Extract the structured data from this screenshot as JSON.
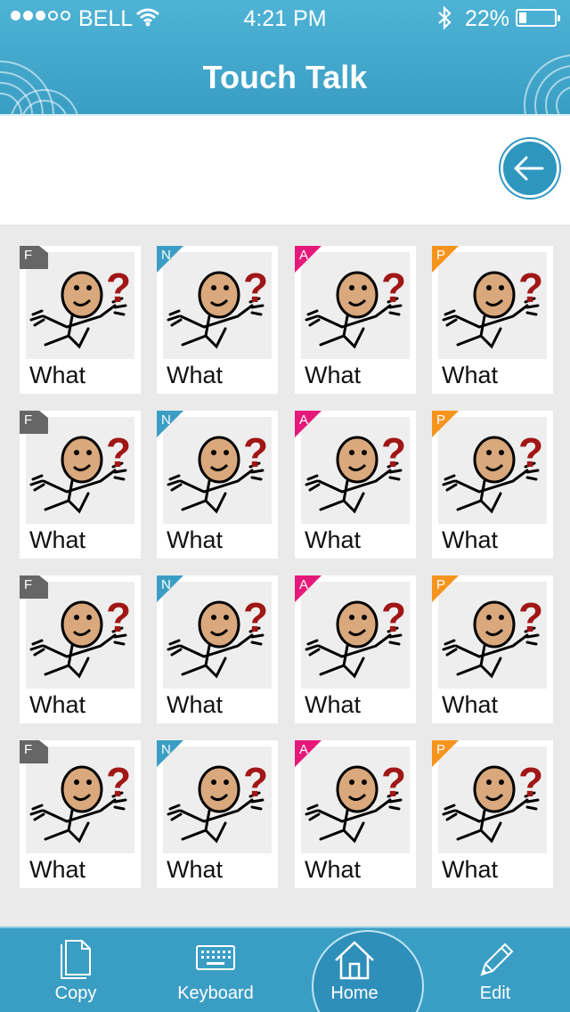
{
  "status_bar": {
    "carrier": "BELL",
    "time": "4:21 PM",
    "battery_percent": "22%",
    "battery_level": 0.22,
    "signal_bars_filled": 3,
    "signal_bars_total": 5
  },
  "header": {
    "title": "Touch Talk"
  },
  "message_bar": {
    "text": ""
  },
  "colors": {
    "header": "#3a9ec4",
    "F": "#666666",
    "N": "#3a9ec4",
    "A": "#e6197a",
    "P": "#f7941d"
  },
  "grid": {
    "rows": [
      [
        {
          "label": "What",
          "badge": "F"
        },
        {
          "label": "What",
          "badge": "N"
        },
        {
          "label": "What",
          "badge": "A"
        },
        {
          "label": "What",
          "badge": "P"
        }
      ],
      [
        {
          "label": "What",
          "badge": "F"
        },
        {
          "label": "What",
          "badge": "N"
        },
        {
          "label": "What",
          "badge": "A"
        },
        {
          "label": "What",
          "badge": "P"
        }
      ],
      [
        {
          "label": "What",
          "badge": "F"
        },
        {
          "label": "What",
          "badge": "N"
        },
        {
          "label": "What",
          "badge": "A"
        },
        {
          "label": "What",
          "badge": "P"
        }
      ],
      [
        {
          "label": "What",
          "badge": "F"
        },
        {
          "label": "What",
          "badge": "N"
        },
        {
          "label": "What",
          "badge": "A"
        },
        {
          "label": "What",
          "badge": "P"
        }
      ]
    ],
    "symbol_icon": "person-question-icon"
  },
  "tabbar": {
    "tabs": [
      {
        "label": "Copy",
        "icon": "document-icon"
      },
      {
        "label": "Keyboard",
        "icon": "keyboard-icon"
      },
      {
        "label": "Home",
        "icon": "home-icon",
        "selected": true
      },
      {
        "label": "Edit",
        "icon": "pencil-icon"
      }
    ]
  }
}
